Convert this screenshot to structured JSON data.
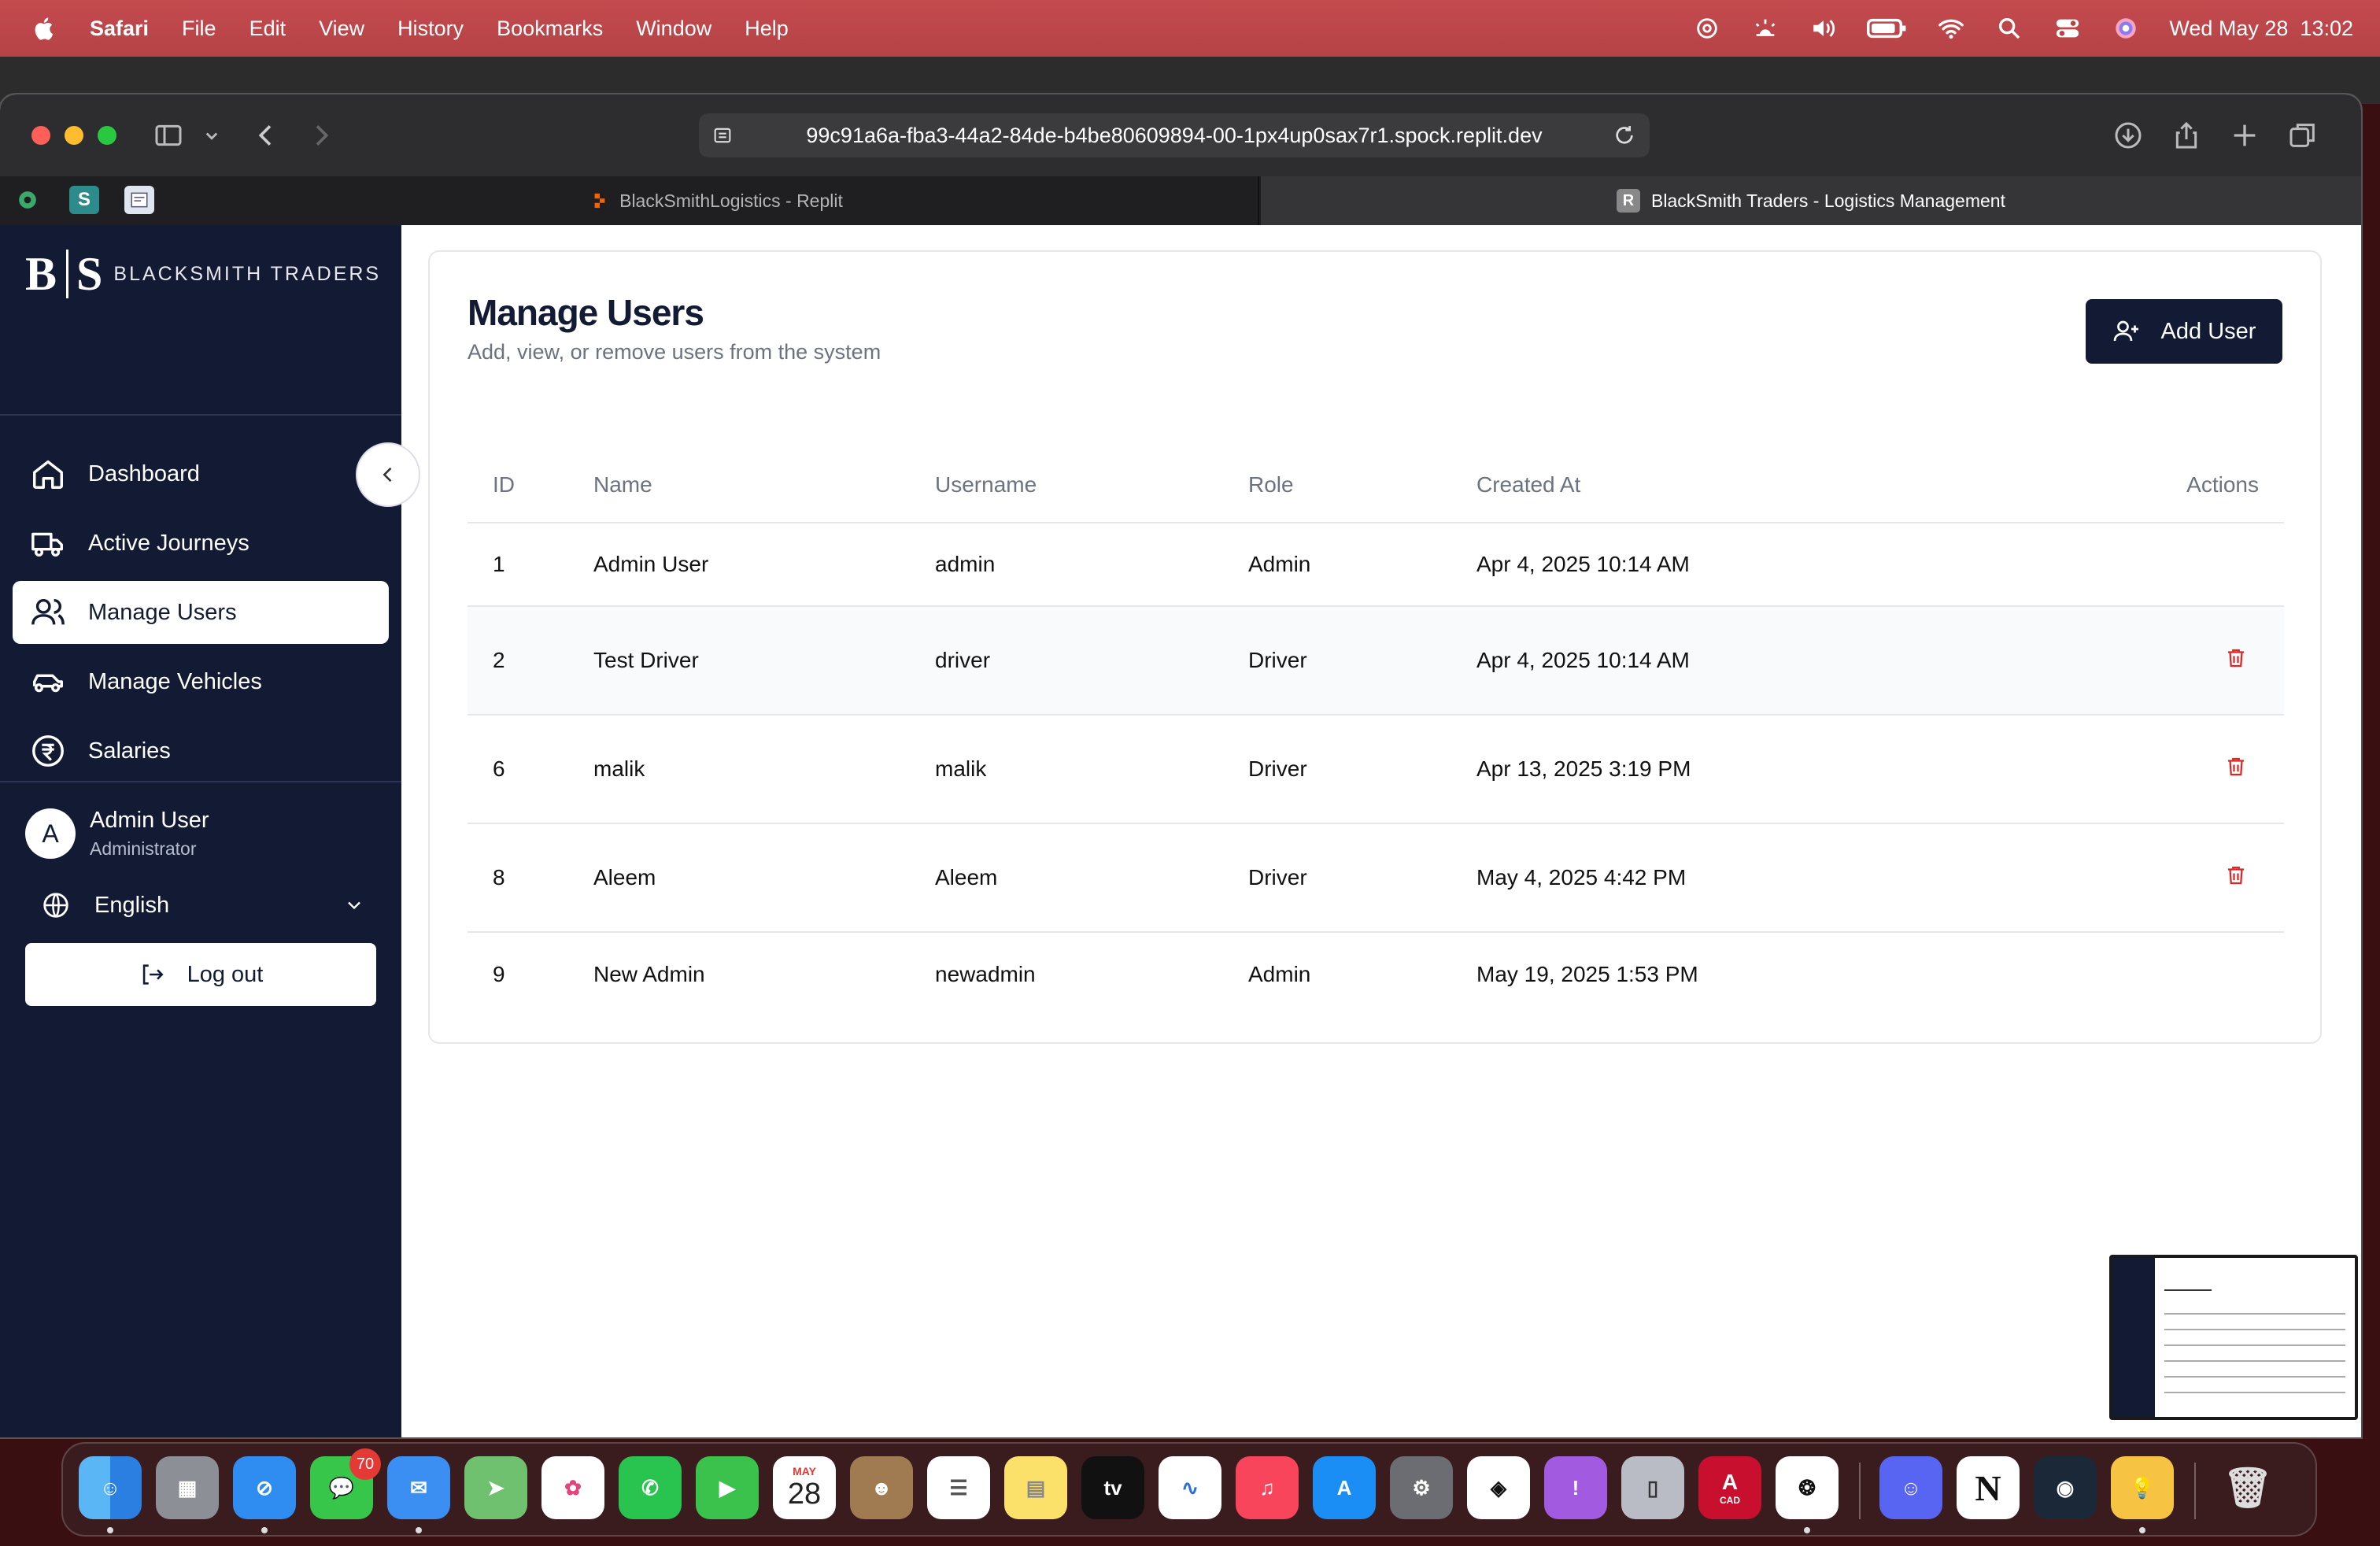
{
  "menubar": {
    "items": [
      "Safari",
      "File",
      "Edit",
      "View",
      "History",
      "Bookmarks",
      "Window",
      "Help"
    ],
    "datetime": "Wed May 28  13:02"
  },
  "browser": {
    "url": "99c91a6a-fba3-44a2-84de-b4be80609894-00-1px4up0sax7r1.spock.replit.dev",
    "tabs": [
      {
        "title": "BlackSmithLogistics - Replit"
      },
      {
        "title": "BlackSmith Traders - Logistics Management",
        "icon_letter": "R"
      }
    ],
    "pinned": [
      "S"
    ]
  },
  "sidebar": {
    "logo": "B S",
    "brand_name": "BLACKSMITH TRADERS",
    "items": [
      {
        "label": "Dashboard",
        "icon": "home-icon"
      },
      {
        "label": "Active Journeys",
        "icon": "truck-icon"
      },
      {
        "label": "Manage Users",
        "icon": "users-icon",
        "active": true
      },
      {
        "label": "Manage Vehicles",
        "icon": "car-icon"
      },
      {
        "label": "Salaries",
        "icon": "rupee-icon"
      }
    ],
    "user": {
      "initial": "A",
      "name": "Admin User",
      "role": "Administrator"
    },
    "language": "English",
    "logout_label": "Log out"
  },
  "main": {
    "title": "Manage Users",
    "subtitle": "Add, view, or remove users from the system",
    "add_button": "Add User",
    "table": {
      "headers": {
        "id": "ID",
        "name": "Name",
        "username": "Username",
        "role": "Role",
        "created": "Created At",
        "actions": "Actions"
      },
      "rows": [
        {
          "id": "1",
          "name": "Admin User",
          "username": "admin",
          "role": "Admin",
          "created": "Apr 4, 2025 10:14 AM"
        },
        {
          "id": "2",
          "name": "Test Driver",
          "username": "driver",
          "role": "Driver",
          "created": "Apr 4, 2025 10:14 AM"
        },
        {
          "id": "6",
          "name": "malik",
          "username": "malik",
          "role": "Driver",
          "created": "Apr 13, 2025 3:19 PM"
        },
        {
          "id": "8",
          "name": "Aleem",
          "username": "Aleem",
          "role": "Driver",
          "created": "May 4, 2025 4:42 PM"
        },
        {
          "id": "9",
          "name": "New Admin",
          "username": "newadmin",
          "role": "Admin",
          "created": "May 19, 2025 1:53 PM"
        }
      ]
    }
  },
  "dock": {
    "messages_badge": "70",
    "calendar_month": "MAY",
    "calendar_day": "28",
    "tv_label": "tv",
    "cad_label": "CAD"
  },
  "colors": {
    "sidebar_bg": "#121a34",
    "primary": "#121a34",
    "delete": "#dc2626",
    "menubar": "#b54346"
  }
}
